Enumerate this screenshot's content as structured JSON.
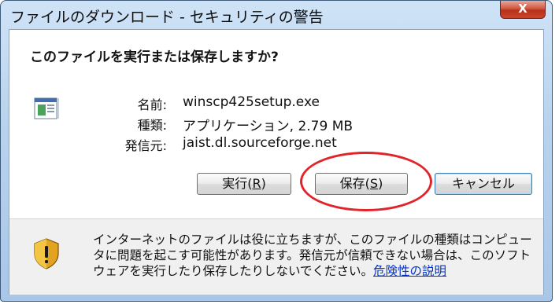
{
  "window": {
    "title": "ファイルのダウンロード - セキュリティの警告",
    "close_label": "X"
  },
  "dialog": {
    "question": "このファイルを実行または保存しますか?",
    "file": {
      "icon": "executable-file-icon",
      "name_label": "名前:",
      "name_value": "winscp425setup.exe",
      "type_label": "種類:",
      "type_value": "アプリケーション, 2.79 MB",
      "from_label": "発信元:",
      "from_value": "jaist.dl.sourceforge.net"
    },
    "buttons": {
      "run_label": "実行(",
      "run_key": "R",
      "save_label": "保存(",
      "save_key": "S",
      "cancel_label": "キャンセル"
    },
    "warning": {
      "icon": "shield-warning-icon",
      "text": "インターネットのファイルは役に立ちますが、このファイルの種類はコンピュータに問題を起こす可能性があります。発信元が信頼できない場合は、このソフトウェアを実行したり保存したりしないでください。",
      "link_text": "危険性の説明"
    }
  },
  "annotation": {
    "circle_color": "#e0242a"
  }
}
